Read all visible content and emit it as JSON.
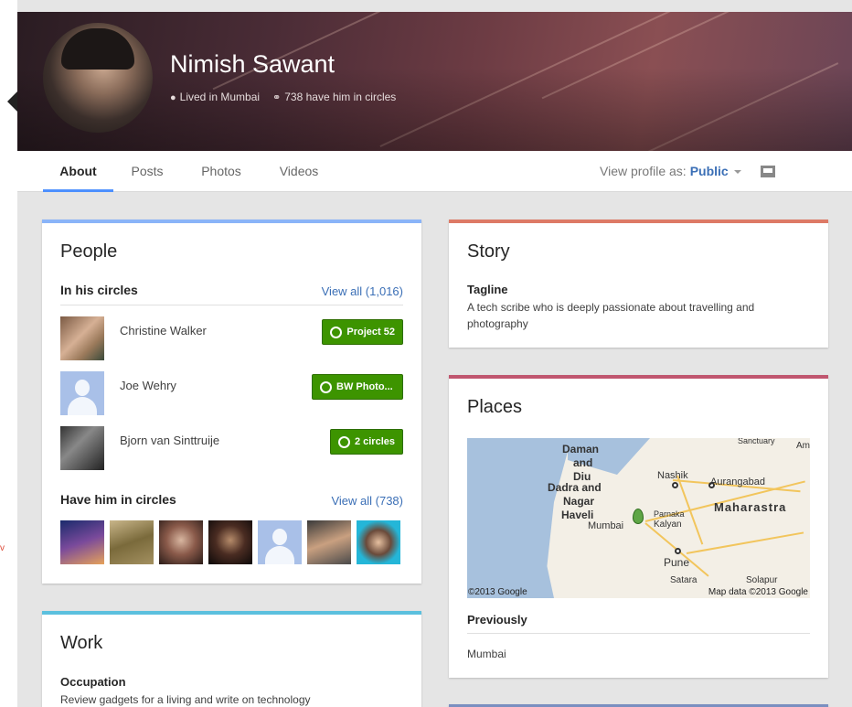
{
  "profile": {
    "name": "Nimish Sawant",
    "location": "Lived in Mumbai",
    "circles_count": "738 have him in circles"
  },
  "tabs": [
    {
      "label": "About",
      "active": true
    },
    {
      "label": "Posts",
      "active": false
    },
    {
      "label": "Photos",
      "active": false
    },
    {
      "label": "Videos",
      "active": false
    }
  ],
  "view_as": {
    "label": "View profile as:",
    "value": "Public"
  },
  "people": {
    "title": "People",
    "in_circles": {
      "heading": "In his circles",
      "view_all": "View all (1,016)",
      "members": [
        {
          "name": "Christine Walker",
          "button": "Project 52"
        },
        {
          "name": "Joe Wehry",
          "button": "BW Photo..."
        },
        {
          "name": "Bjorn van Sinttruije",
          "button": "2 circles"
        }
      ]
    },
    "have_him": {
      "heading": "Have him in circles",
      "view_all": "View all (738)"
    }
  },
  "work": {
    "title": "Work",
    "occupation_label": "Occupation",
    "occupation": "Review gadgets for a living and write on technology"
  },
  "story": {
    "title": "Story",
    "tagline_label": "Tagline",
    "tagline": "A tech scribe who is deeply passionate about travelling and photography"
  },
  "places": {
    "title": "Places",
    "previously_label": "Previously",
    "previously": "Mumbai",
    "map": {
      "labels": [
        "Daman",
        "and",
        "Diu",
        "Dadra and",
        "Nagar",
        "Haveli",
        "Nashik",
        "Aurangabad",
        "Maharastra",
        "Mumbai",
        "Parnaka",
        "Kalyan",
        "Pune",
        "Satara",
        "Solapur",
        "Sanctuary",
        "Am"
      ],
      "copyright": "©2013 Google",
      "map_data": "Map data ©2013 Google"
    }
  },
  "colors": {
    "people_bar": "#8ab4f8",
    "work_bar": "#5bc0de",
    "story_bar": "#dd7a66",
    "places_bar": "#c0566f",
    "circle_button": "#3d9400",
    "link": "#3b6fb6"
  }
}
